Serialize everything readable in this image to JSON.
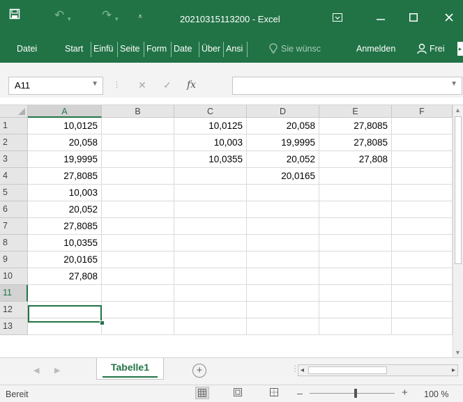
{
  "app": {
    "doc_title": "20210315113200 - Excel",
    "accent_color": "#217346",
    "qat_icons": [
      "save-icon",
      "undo-icon",
      "redo-icon",
      "customize-qat-icon"
    ],
    "window_icons": [
      "ribbon-display-options-icon",
      "minimize-icon",
      "maximize-icon",
      "close-icon"
    ]
  },
  "ribbon": {
    "tabs": [
      "Datei",
      "Start",
      "Einfü",
      "Seite",
      "Form",
      "Date",
      "Über",
      "Ansi"
    ],
    "tell_me": "Sie wünsc",
    "sign_in": "Anmelden",
    "share": "Frei"
  },
  "formula_bar": {
    "name_box": "A11",
    "fx_label": "fx",
    "formula": ""
  },
  "grid": {
    "columns": [
      "A",
      "B",
      "C",
      "D",
      "E",
      "F"
    ],
    "selected_column": "A",
    "selected_row": 11,
    "selected_cell": "A11",
    "rows": [
      {
        "n": "1",
        "cells": [
          "10,0125",
          "",
          "10,0125",
          "20,058",
          "27,8085",
          ""
        ]
      },
      {
        "n": "2",
        "cells": [
          "20,058",
          "",
          "10,003",
          "19,9995",
          "27,8085",
          ""
        ]
      },
      {
        "n": "3",
        "cells": [
          "19,9995",
          "",
          "10,0355",
          "20,052",
          "27,808",
          ""
        ]
      },
      {
        "n": "4",
        "cells": [
          "27,8085",
          "",
          "",
          "20,0165",
          "",
          ""
        ]
      },
      {
        "n": "5",
        "cells": [
          "10,003",
          "",
          "",
          "",
          "",
          ""
        ]
      },
      {
        "n": "6",
        "cells": [
          "20,052",
          "",
          "",
          "",
          "",
          ""
        ]
      },
      {
        "n": "7",
        "cells": [
          "27,8085",
          "",
          "",
          "",
          "",
          ""
        ]
      },
      {
        "n": "8",
        "cells": [
          "10,0355",
          "",
          "",
          "",
          "",
          ""
        ]
      },
      {
        "n": "9",
        "cells": [
          "20,0165",
          "",
          "",
          "",
          "",
          ""
        ]
      },
      {
        "n": "10",
        "cells": [
          "27,808",
          "",
          "",
          "",
          "",
          ""
        ]
      },
      {
        "n": "11",
        "cells": [
          "",
          "",
          "",
          "",
          "",
          ""
        ]
      },
      {
        "n": "12",
        "cells": [
          "",
          "",
          "",
          "",
          "",
          ""
        ]
      },
      {
        "n": "13",
        "cells": [
          "",
          "",
          "",
          "",
          "",
          ""
        ]
      }
    ]
  },
  "sheets": {
    "tabs": [
      "Tabelle1"
    ],
    "active": "Tabelle1"
  },
  "status": {
    "text": "Bereit",
    "zoom": "100 %",
    "zoom_percent": 100,
    "view_modes": [
      "normal-view-icon",
      "page-layout-view-icon",
      "page-break-preview-icon"
    ]
  }
}
